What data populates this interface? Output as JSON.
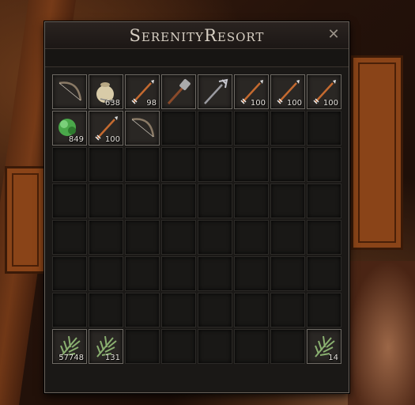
{
  "window": {
    "title": "SerenityResort",
    "close_label": "✕"
  },
  "slots": [
    {
      "item": "bow-icon",
      "count": ""
    },
    {
      "item": "sack-icon",
      "count": "638"
    },
    {
      "item": "arrow-icon",
      "count": "98"
    },
    {
      "item": "mace-icon",
      "count": ""
    },
    {
      "item": "trident-icon",
      "count": ""
    },
    {
      "item": "arrow-icon",
      "count": "100"
    },
    {
      "item": "arrow-icon",
      "count": "100"
    },
    {
      "item": "arrow-icon",
      "count": "100"
    },
    {
      "item": "herb-green-icon",
      "count": "849"
    },
    {
      "item": "arrow-icon",
      "count": "100"
    },
    {
      "item": "bow-icon",
      "count": ""
    },
    {
      "item": "",
      "count": ""
    },
    {
      "item": "",
      "count": ""
    },
    {
      "item": "",
      "count": ""
    },
    {
      "item": "",
      "count": ""
    },
    {
      "item": "",
      "count": ""
    },
    {
      "item": "",
      "count": ""
    },
    {
      "item": "",
      "count": ""
    },
    {
      "item": "",
      "count": ""
    },
    {
      "item": "",
      "count": ""
    },
    {
      "item": "",
      "count": ""
    },
    {
      "item": "",
      "count": ""
    },
    {
      "item": "",
      "count": ""
    },
    {
      "item": "",
      "count": ""
    },
    {
      "item": "",
      "count": ""
    },
    {
      "item": "",
      "count": ""
    },
    {
      "item": "",
      "count": ""
    },
    {
      "item": "",
      "count": ""
    },
    {
      "item": "",
      "count": ""
    },
    {
      "item": "",
      "count": ""
    },
    {
      "item": "",
      "count": ""
    },
    {
      "item": "",
      "count": ""
    },
    {
      "item": "",
      "count": ""
    },
    {
      "item": "",
      "count": ""
    },
    {
      "item": "",
      "count": ""
    },
    {
      "item": "",
      "count": ""
    },
    {
      "item": "",
      "count": ""
    },
    {
      "item": "",
      "count": ""
    },
    {
      "item": "",
      "count": ""
    },
    {
      "item": "",
      "count": ""
    },
    {
      "item": "",
      "count": ""
    },
    {
      "item": "",
      "count": ""
    },
    {
      "item": "",
      "count": ""
    },
    {
      "item": "",
      "count": ""
    },
    {
      "item": "",
      "count": ""
    },
    {
      "item": "",
      "count": ""
    },
    {
      "item": "",
      "count": ""
    },
    {
      "item": "",
      "count": ""
    },
    {
      "item": "",
      "count": ""
    },
    {
      "item": "",
      "count": ""
    },
    {
      "item": "",
      "count": ""
    },
    {
      "item": "",
      "count": ""
    },
    {
      "item": "",
      "count": ""
    },
    {
      "item": "",
      "count": ""
    },
    {
      "item": "",
      "count": ""
    },
    {
      "item": "",
      "count": ""
    },
    {
      "item": "herb-fern-icon",
      "count": "57748"
    },
    {
      "item": "herb-fern-icon",
      "count": "131"
    },
    {
      "item": "",
      "count": ""
    },
    {
      "item": "",
      "count": ""
    },
    {
      "item": "",
      "count": ""
    },
    {
      "item": "",
      "count": ""
    },
    {
      "item": "",
      "count": ""
    },
    {
      "item": "herb-fern-icon",
      "count": "14"
    }
  ],
  "colors": {
    "panel": "#1a1816",
    "slot_border": "#6e6a64",
    "title": "#d8d0c4"
  }
}
